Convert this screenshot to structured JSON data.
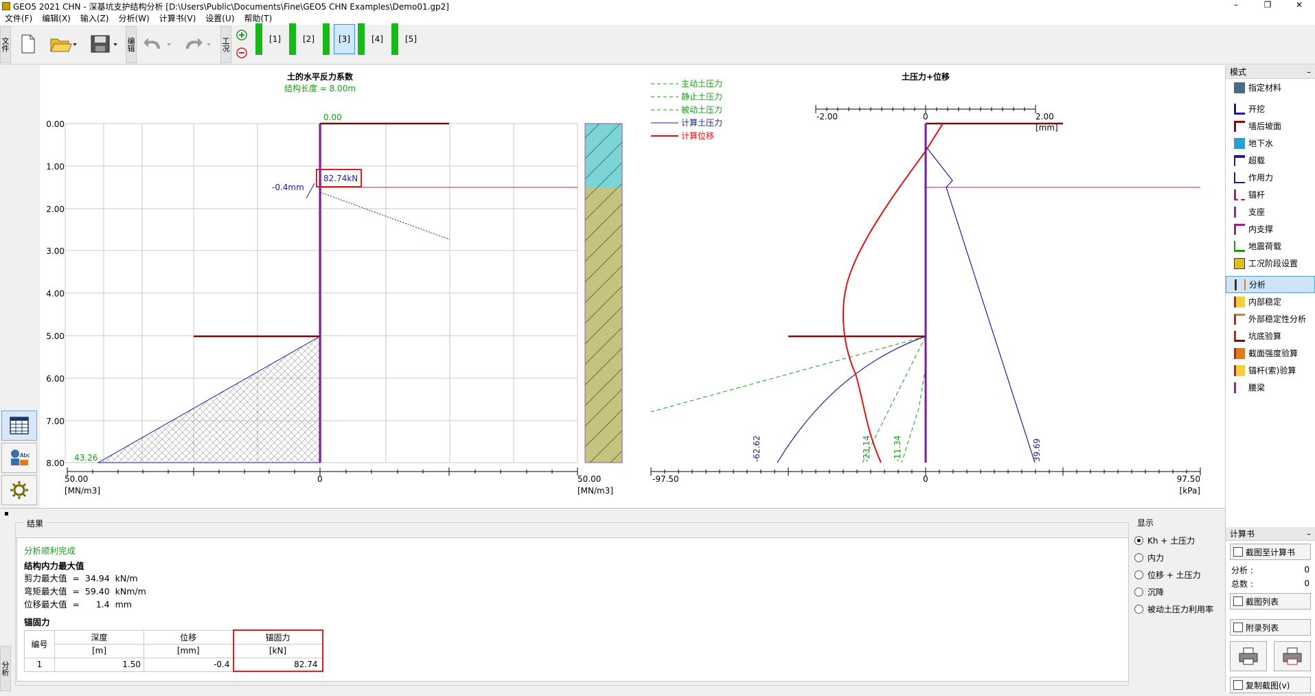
{
  "window": {
    "title": "GEO5 2021 CHN - 深基坑支护结构分析 [D:\\Users\\Public\\Documents\\Fine\\GEO5 CHN Examples\\Demo01.gp2]",
    "minimize": "–",
    "maximize": "❐",
    "close": "✕"
  },
  "menu": [
    "文件(F)",
    "编辑(X)",
    "输入(Z)",
    "分析(W)",
    "计算书(V)",
    "设置(U)",
    "帮助(T)"
  ],
  "toolbar": {
    "file_tab": "文件",
    "edit_tab": "编辑",
    "stage_tab": "工况",
    "stages": [
      "[1]",
      "[2]",
      "[3]",
      "[4]",
      "[5]"
    ],
    "active_stage": "[3]"
  },
  "left_chart": {
    "title": "土的水平反力系数",
    "subtitle": "结构长度 = 8.00m",
    "depth_ticks": [
      "0.00",
      "1.00",
      "2.00",
      "3.00",
      "4.00",
      "5.00",
      "6.00",
      "7.00",
      "8.00"
    ],
    "top_value": "0.00",
    "anchor_force": "82.74kN",
    "anchor_disp": "-0.4mm",
    "bottom_value": "43.26",
    "axis_left": "50.00",
    "axis_zero": "0",
    "axis_right": "50.00",
    "unit_left": "[MN/m3]",
    "unit_right": "[MN/m3]"
  },
  "right_chart": {
    "title": "土压力+位移",
    "legend": [
      {
        "label": "主动土压力",
        "color": "#1a9a1a",
        "style": "dash"
      },
      {
        "label": "静止土压力",
        "color": "#1a9a1a",
        "style": "dash"
      },
      {
        "label": "被动土压力",
        "color": "#1a9a1a",
        "style": "dash"
      },
      {
        "label": "计算土压力",
        "color": "#1c1c9c",
        "style": "solid"
      },
      {
        "label": "计算位移",
        "color": "#e01010",
        "style": "solid"
      }
    ],
    "disp_left": "-2.00",
    "disp_zero": "0",
    "disp_right": "2.00",
    "disp_unit": "[mm]",
    "value_labels": [
      "-62.62",
      "-23.14",
      "-11.34",
      "39.69"
    ],
    "axis_left": "-97.50",
    "axis_zero": "0",
    "axis_right": "97.50",
    "axis_unit": "[kPa]"
  },
  "results": {
    "section": "结果",
    "status": "分析顺利完成",
    "heading": "结构内力最大值",
    "lines": [
      "剪力最大值  =  34.94  kN/m",
      "弯矩最大值  =  59.40  kNm/m",
      "位移最大值  =      1.4  mm"
    ],
    "anchor_heading": "锚固力",
    "table_headers": [
      "编号",
      "深度",
      "位移",
      "锚固力"
    ],
    "table_units": [
      "",
      "[m]",
      "[mm]",
      "[kN]"
    ],
    "table_rows": [
      [
        "1",
        "1.50",
        "-0.4",
        "82.74"
      ]
    ]
  },
  "display": {
    "section": "显示",
    "options": [
      "Kh + 土压力",
      "内力",
      "位移 + 土压力",
      "沉降",
      "被动土压力利用率"
    ],
    "selected": "Kh + 土压力"
  },
  "mode_panel": {
    "title": "模式",
    "items": [
      "指定材料",
      "开挖",
      "墙后坡面",
      "地下水",
      "超载",
      "作用力",
      "锚杆",
      "支座",
      "内支撑",
      "地震荷载",
      "工况阶段设置",
      "分析",
      "内部稳定",
      "外部稳定性分析",
      "坑底验算",
      "截面强度验算",
      "锚杆(索)验算",
      "腰梁"
    ],
    "selected": "分析"
  },
  "report_panel": {
    "title": "计算书",
    "add_button": "截图至计算书",
    "analysis_label": "分析 :",
    "analysis_value": "0",
    "total_label": "总数 :",
    "total_value": "0",
    "list_button": "截图列表",
    "appendix_button": "附录列表",
    "copy_button": "复制截图(v)"
  },
  "bottom_vtab": "分析"
}
